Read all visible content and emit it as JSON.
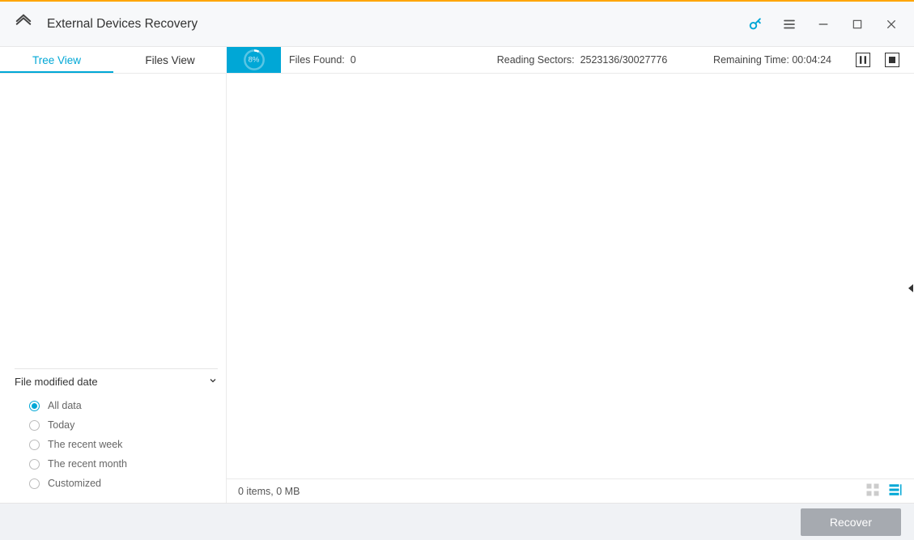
{
  "titlebar": {
    "title": "External Devices Recovery"
  },
  "tabs": {
    "tree_view": "Tree View",
    "files_view": "Files View",
    "active": "tree_view"
  },
  "progress": {
    "percent_label": "8%",
    "files_found_label": "Files Found:",
    "files_found_value": "0",
    "reading_sectors_label": "Reading Sectors:",
    "reading_sectors_value": "2523136/30027776",
    "remaining_time_label": "Remaining Time:",
    "remaining_time_value": "00:04:24"
  },
  "filter": {
    "header": "File modified date",
    "options": [
      {
        "label": "All data",
        "selected": true
      },
      {
        "label": "Today",
        "selected": false
      },
      {
        "label": "The recent week",
        "selected": false
      },
      {
        "label": "The recent month",
        "selected": false
      },
      {
        "label": "Customized",
        "selected": false
      }
    ]
  },
  "content_status": {
    "summary": "0 items, 0 MB"
  },
  "actions": {
    "recover": "Recover"
  }
}
